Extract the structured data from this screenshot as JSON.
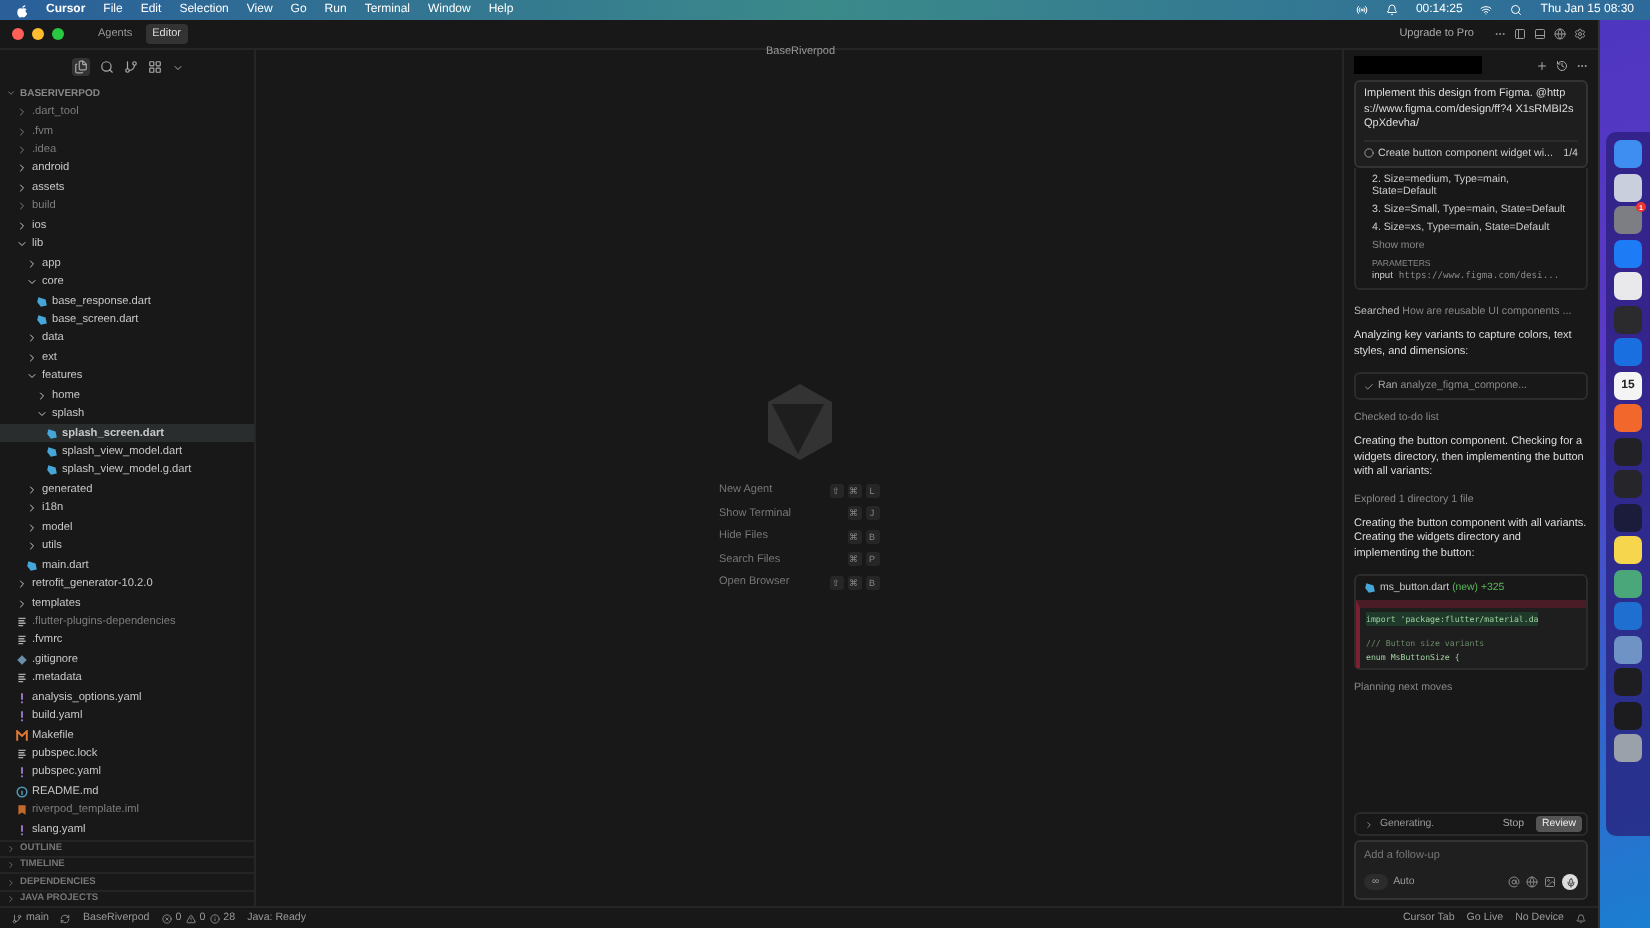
{
  "menu_bar": {
    "app": "Cursor",
    "items": [
      "File",
      "Edit",
      "Selection",
      "View",
      "Go",
      "Run",
      "Terminal",
      "Window",
      "Help"
    ],
    "timer": "00:14:25",
    "clock": "Thu Jan 15  08:30"
  },
  "window": {
    "title": "BaseRiverpod",
    "mode_tabs": [
      {
        "label": "Agents",
        "selected": false
      },
      {
        "label": "Editor",
        "selected": true
      }
    ],
    "upgrade": "Upgrade to Pro"
  },
  "explorer": {
    "root": "BASERIVERPOD",
    "tree": [
      {
        "name": ".dart_tool",
        "kind": "folder",
        "expanded": false,
        "dimmed": true,
        "selected": false
      },
      {
        "name": ".fvm",
        "kind": "folder",
        "expanded": false,
        "dimmed": true,
        "selected": false
      },
      {
        "name": ".idea",
        "kind": "folder",
        "expanded": false,
        "dimmed": true,
        "selected": false
      },
      {
        "name": "android",
        "kind": "folder",
        "expanded": false,
        "dimmed": false,
        "selected": false
      },
      {
        "name": "assets",
        "kind": "folder",
        "expanded": false,
        "dimmed": false,
        "selected": false
      },
      {
        "name": "build",
        "kind": "folder",
        "expanded": false,
        "dimmed": true,
        "selected": false
      },
      {
        "name": "ios",
        "kind": "folder",
        "expanded": false,
        "dimmed": false,
        "selected": false
      },
      {
        "name": "lib",
        "kind": "folder",
        "expanded": true,
        "dimmed": false,
        "selected": false,
        "children": [
          {
            "name": "app",
            "kind": "folder",
            "expanded": false,
            "dimmed": false,
            "selected": false
          },
          {
            "name": "core",
            "kind": "folder",
            "expanded": true,
            "dimmed": false,
            "selected": false,
            "children": [
              {
                "name": "base_response.dart",
                "kind": "dart",
                "dimmed": false,
                "selected": false
              },
              {
                "name": "base_screen.dart",
                "kind": "dart",
                "dimmed": false,
                "selected": false
              }
            ]
          },
          {
            "name": "data",
            "kind": "folder",
            "expanded": false,
            "dimmed": false,
            "selected": false
          },
          {
            "name": "ext",
            "kind": "folder",
            "expanded": false,
            "dimmed": false,
            "selected": false
          },
          {
            "name": "features",
            "kind": "folder",
            "expanded": true,
            "dimmed": false,
            "selected": false,
            "children": [
              {
                "name": "home",
                "kind": "folder",
                "expanded": false,
                "dimmed": false,
                "selected": false
              },
              {
                "name": "splash",
                "kind": "folder",
                "expanded": true,
                "dimmed": false,
                "selected": false,
                "children": [
                  {
                    "name": "splash_screen.dart",
                    "kind": "dart",
                    "dimmed": false,
                    "selected": true
                  },
                  {
                    "name": "splash_view_model.dart",
                    "kind": "dart",
                    "dimmed": false,
                    "selected": false
                  },
                  {
                    "name": "splash_view_model.g.dart",
                    "kind": "dart",
                    "dimmed": false,
                    "selected": false
                  }
                ]
              }
            ]
          },
          {
            "name": "generated",
            "kind": "folder",
            "expanded": false,
            "dimmed": false,
            "selected": false
          },
          {
            "name": "i18n",
            "kind": "folder",
            "expanded": false,
            "dimmed": false,
            "selected": false
          },
          {
            "name": "model",
            "kind": "folder",
            "expanded": false,
            "dimmed": false,
            "selected": false
          },
          {
            "name": "utils",
            "kind": "folder",
            "expanded": false,
            "dimmed": false,
            "selected": false
          },
          {
            "name": "main.dart",
            "kind": "dart",
            "dimmed": false,
            "selected": false
          }
        ]
      },
      {
        "name": "retrofit_generator-10.2.0",
        "kind": "folder",
        "expanded": false,
        "dimmed": false,
        "selected": false
      },
      {
        "name": "templates",
        "kind": "folder",
        "expanded": false,
        "dimmed": false,
        "selected": false
      },
      {
        "name": ".flutter-plugins-dependencies",
        "kind": "text",
        "dimmed": true,
        "selected": false
      },
      {
        "name": ".fvmrc",
        "kind": "text",
        "dimmed": false,
        "selected": false
      },
      {
        "name": ".gitignore",
        "kind": "git",
        "dimmed": false,
        "selected": false
      },
      {
        "name": ".metadata",
        "kind": "text",
        "dimmed": false,
        "selected": false
      },
      {
        "name": "analysis_options.yaml",
        "kind": "yaml",
        "dimmed": false,
        "selected": false
      },
      {
        "name": "build.yaml",
        "kind": "yaml",
        "dimmed": false,
        "selected": false
      },
      {
        "name": "Makefile",
        "kind": "make",
        "dimmed": false,
        "selected": false
      },
      {
        "name": "pubspec.lock",
        "kind": "text",
        "dimmed": false,
        "selected": false
      },
      {
        "name": "pubspec.yaml",
        "kind": "yaml",
        "dimmed": false,
        "selected": false
      },
      {
        "name": "README.md",
        "kind": "info",
        "dimmed": false,
        "selected": false
      },
      {
        "name": "riverpod_template.iml",
        "kind": "iml",
        "dimmed": true,
        "selected": false
      },
      {
        "name": "slang.yaml",
        "kind": "yaml",
        "dimmed": false,
        "selected": false
      }
    ],
    "sections": [
      "OUTLINE",
      "TIMELINE",
      "DEPENDENCIES",
      "JAVA PROJECTS"
    ]
  },
  "editor_welcome": {
    "shortcuts": [
      {
        "label": "New Agent",
        "keys": [
          "⇧",
          "⌘",
          "L"
        ]
      },
      {
        "label": "Show Terminal",
        "keys": [
          "⌘",
          "J"
        ]
      },
      {
        "label": "Hide Files",
        "keys": [
          "⌘",
          "B"
        ]
      },
      {
        "label": "Search Files",
        "keys": [
          "⌘",
          "P"
        ]
      },
      {
        "label": "Open Browser",
        "keys": [
          "⇧",
          "⌘",
          "B"
        ]
      }
    ]
  },
  "agent_panel": {
    "prompt": "Implement this design from Figma. @https://www.figma.com/design/ff?4 X1sRMBI2sQpXdevha/",
    "todo": {
      "text": "Create button component widget wi...",
      "count": "1/4"
    },
    "steps": [
      "2. Size=medium, Type=main, State=Default",
      "3. Size=Small, Type=main, State=Default",
      "4. Size=xs, Type=main, State=Default"
    ],
    "show_more": "Show more",
    "parameters_label": "PARAMETERS",
    "parameter": {
      "key": "input",
      "value": "https://www.figma.com/desi..."
    },
    "feed": [
      {
        "kind": "searched",
        "label": "Searched",
        "text": "How are reusable UI components ..."
      },
      {
        "kind": "text",
        "text": "Analyzing key variants to capture colors, text styles, and dimensions:"
      },
      {
        "kind": "tool",
        "label": "Ran",
        "text": "analyze_figma_compone..."
      },
      {
        "kind": "status",
        "text": "Checked to-do list"
      },
      {
        "kind": "text",
        "text": "Creating the button component. Checking for a widgets directory, then implementing the button with all variants:"
      },
      {
        "kind": "status",
        "text": "Explored 1 directory 1 file"
      },
      {
        "kind": "text",
        "text": "Creating the button component with all variants. Creating the widgets directory and implementing the button:"
      },
      {
        "kind": "code",
        "file": "ms_button.dart",
        "tag": "(new)",
        "added": "+325",
        "lines": [
          "import 'package:flutter/material.da",
          "/// Button size variants",
          "enum MsButtonSize {"
        ]
      },
      {
        "kind": "status",
        "text": "Planning next moves"
      }
    ],
    "generating": "Generating.",
    "stop": "Stop",
    "review": "Review",
    "placeholder": "Add a follow-up",
    "mode": "∞",
    "model": "Auto"
  },
  "status_bar": {
    "branch": "main",
    "project": "BaseRiverpod",
    "errors": "0",
    "warnings": "0",
    "infos": "28",
    "java": "Java: Ready",
    "right": [
      "Cursor Tab",
      "Go Live",
      "No Device"
    ]
  },
  "dock": [
    {
      "color": "#3d8ef0"
    },
    {
      "color": "#c9cfdc"
    },
    {
      "color": "#7d7d84",
      "badge": "1"
    },
    {
      "color": "#1d7cf5"
    },
    {
      "color": "#e9e9ec"
    },
    {
      "color": "#2b2b2e"
    },
    {
      "color": "#1a6fe0"
    },
    {
      "color": "#f4f4f4",
      "label": "15"
    },
    {
      "color": "#f2682c"
    },
    {
      "color": "#222226"
    },
    {
      "color": "#25252a"
    },
    {
      "color": "#1b1b3c"
    },
    {
      "color": "#f6d64c"
    },
    {
      "color": "#4aa77a"
    },
    {
      "color": "#1f6fd0"
    },
    {
      "color": "#6e93c4"
    },
    {
      "color": "#1e1e20"
    },
    {
      "color": "#1c1c1e"
    },
    {
      "color": "#9ba1ab"
    }
  ]
}
